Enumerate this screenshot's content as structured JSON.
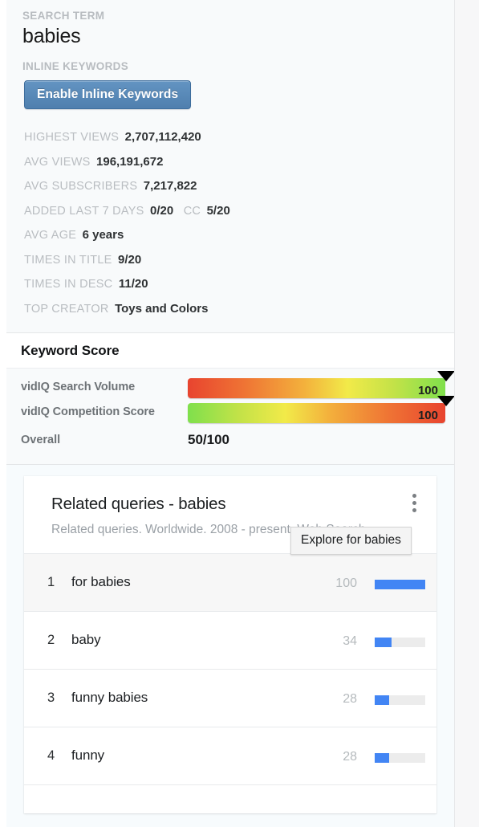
{
  "search": {
    "term_label": "SEARCH TERM",
    "term_value": "babies",
    "inline_keywords_label": "INLINE KEYWORDS",
    "enable_button": "Enable Inline Keywords"
  },
  "stats": [
    {
      "key": "HIGHEST VIEWS",
      "value": "2,707,112,420"
    },
    {
      "key": "AVG VIEWS",
      "value": "196,191,672"
    },
    {
      "key": "AVG SUBSCRIBERS",
      "value": "7,217,822"
    },
    {
      "key": "ADDED LAST 7 DAYS",
      "value": "0/20",
      "key2": "CC",
      "value2": "5/20"
    },
    {
      "key": "AVG AGE",
      "value": "6 years"
    },
    {
      "key": "TIMES IN TITLE",
      "value": "9/20"
    },
    {
      "key": "TIMES IN DESC",
      "value": "11/20"
    },
    {
      "key": "TOP CREATOR",
      "value": "Toys and Colors"
    }
  ],
  "keyword_score": {
    "title": "Keyword Score",
    "search_volume_label": "vidIQ Search Volume",
    "search_volume_value": "100",
    "competition_label": "vidIQ Competition Score",
    "competition_value": "100",
    "overall_label": "Overall",
    "overall_value": "50/100"
  },
  "trends_card": {
    "title": "Related queries - babies",
    "subtitle": "Related queries. Worldwide. 2008 - present. Web Search.",
    "tooltip": "Explore for babies",
    "kebab_name": "more-options"
  },
  "chart_data": {
    "type": "bar",
    "title": "Related queries - babies",
    "subtitle": "Related queries. Worldwide. 2008 - present. Web Search.",
    "orientation": "horizontal",
    "xlabel": "",
    "ylabel": "",
    "ylim": [
      0,
      100
    ],
    "grid": false,
    "legend": "none",
    "categories": [
      "for babies",
      "baby",
      "funny babies",
      "funny"
    ],
    "values": [
      100,
      34,
      28,
      28
    ],
    "ranks": [
      1,
      2,
      3,
      4
    ],
    "bar_color": "#4285f4",
    "track_color": "#ececec"
  },
  "colors": {
    "accent_blue": "#4285f4",
    "button_blue": "#5a86b5",
    "meter_green": "#7fe04c",
    "meter_red": "#e8442f",
    "muted_text": "#b8bcc0"
  }
}
